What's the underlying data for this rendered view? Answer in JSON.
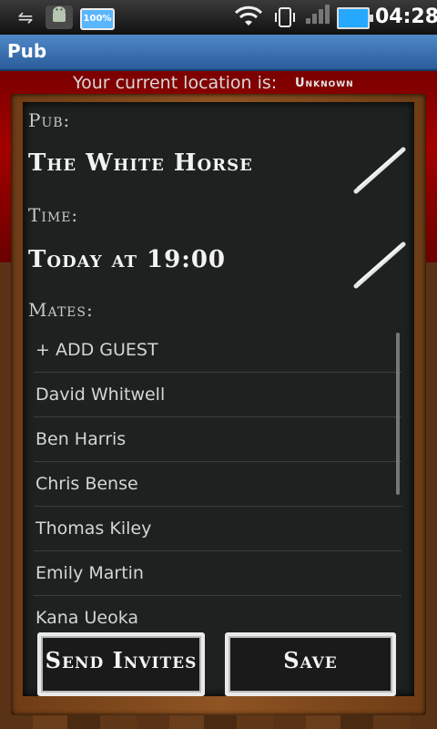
{
  "status_bar": {
    "time": "04:28",
    "battery_small_label": "100%"
  },
  "title_bar": {
    "title": "Pub"
  },
  "location": {
    "label": "Your current location is:",
    "value": "Unknown"
  },
  "board": {
    "pub_label": "Pub:",
    "pub_value": "The White Horse",
    "time_label": "Time:",
    "time_value": "Today at 19:00",
    "mates_label": "Mates:",
    "mates": [
      "+ ADD GUEST",
      "David Whitwell",
      "Ben Harris",
      "Chris Bense",
      "Thomas Kiley",
      "Emily Martin",
      "Kana Ueoka"
    ]
  },
  "buttons": {
    "send_invites": "Send Invites",
    "save": "Save"
  },
  "icons": {
    "usb": "usb-icon",
    "android": "android-debug-icon",
    "wifi": "wifi-icon",
    "vibrate": "vibrate-icon",
    "signal": "signal-icon",
    "battery": "battery-icon",
    "edit": "chalk-edit-icon"
  }
}
